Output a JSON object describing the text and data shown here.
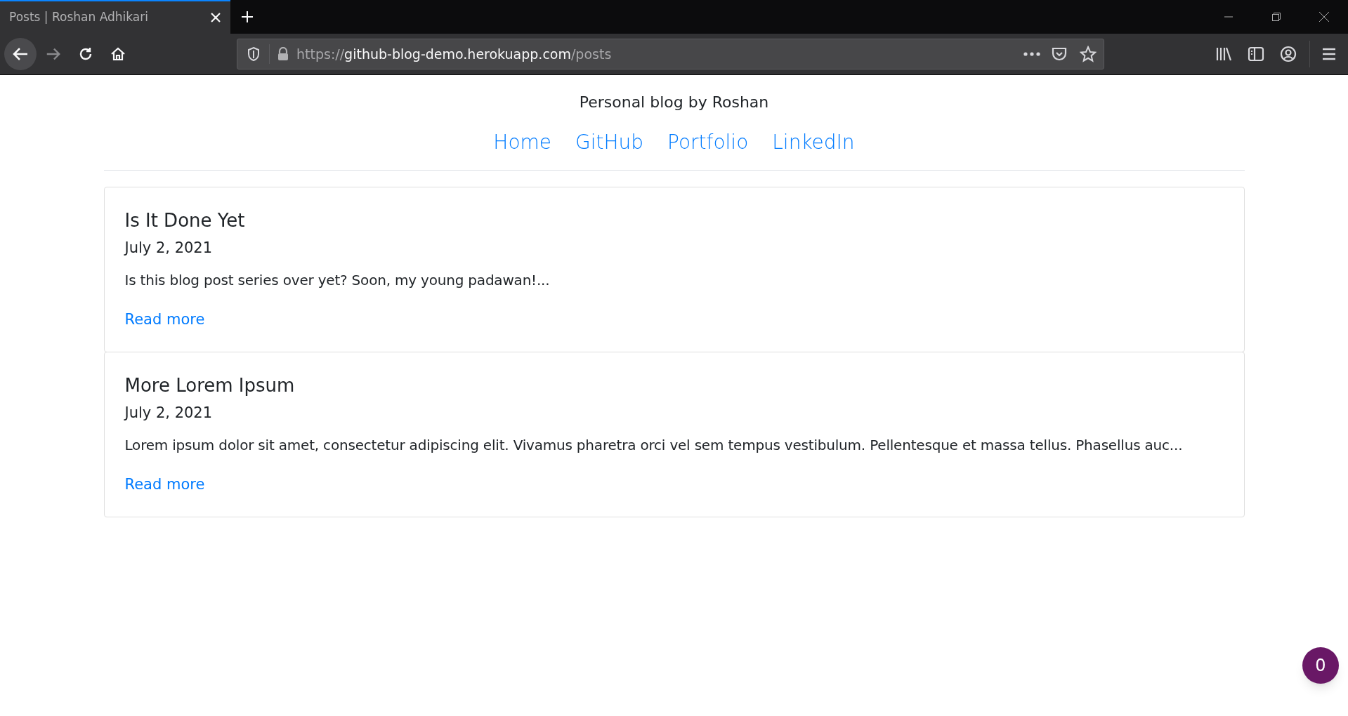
{
  "browser": {
    "tabs": [
      {
        "title": "Posts | Roshan Adhikari",
        "selected": true
      }
    ],
    "address": {
      "scheme": "https://",
      "host": "github-blog-demo.herokuapp.com",
      "path": "/posts"
    }
  },
  "site": {
    "title": "Personal blog by Roshan",
    "nav": [
      "Home",
      "GitHub",
      "Portfolio",
      "LinkedIn"
    ]
  },
  "posts": [
    {
      "title": "Is It Done Yet",
      "date": "July 2, 2021",
      "excerpt": "Is this blog post series over yet? Soon, my young padawan!...",
      "link": "Read more"
    },
    {
      "title": "More Lorem Ipsum",
      "date": "July 2, 2021",
      "excerpt": "Lorem ipsum dolor sit amet, consectetur adipiscing elit. Vivamus pharetra orci vel sem tempus vestibulum. Pellentesque et massa tellus. Phasellus auc...",
      "link": "Read more"
    }
  ],
  "badge": "0"
}
